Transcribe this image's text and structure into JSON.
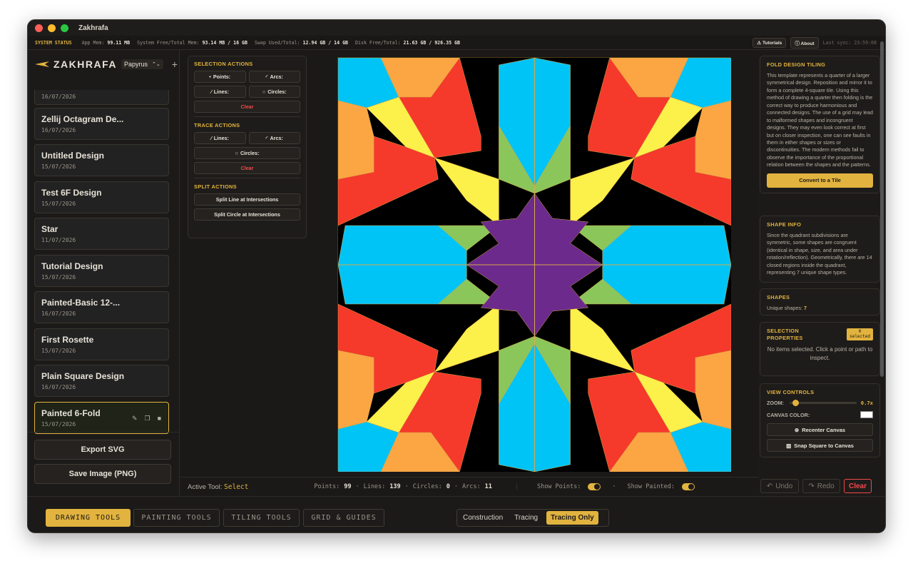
{
  "window": {
    "title": "Zakhrafa"
  },
  "status": {
    "label": "SYSTEM STATUS",
    "app_mem_label": "App Mem:",
    "app_mem": "99.11 MB",
    "sys_mem_label": "System Free/Total Mem:",
    "sys_mem": "93.14 MB / 16 GB",
    "swap_label": "Swap Used/Total:",
    "swap": "12.94 GB / 14 GB",
    "disk_label": "Disk Free/Total:",
    "disk": "21.63 GB / 926.35 GB",
    "tutorials": "Tutorials",
    "about": "About",
    "last_sync": "Last sync: 23:59:08"
  },
  "sidebar": {
    "logo": "ZAKHRAFA",
    "font": "Papyrus",
    "partial_date": "16/07/2026",
    "designs": [
      {
        "name": "Zellij Octagram De...",
        "date": "16/07/2026"
      },
      {
        "name": "Untitled Design",
        "date": "15/07/2026"
      },
      {
        "name": "Test 6F Design",
        "date": "15/07/2026"
      },
      {
        "name": "Star",
        "date": "11/07/2026"
      },
      {
        "name": "Tutorial Design",
        "date": "15/07/2026"
      },
      {
        "name": "Painted-Basic 12-...",
        "date": "16/07/2026"
      },
      {
        "name": "First Rosette",
        "date": "15/07/2026"
      },
      {
        "name": "Plain Square Design",
        "date": "16/07/2026"
      },
      {
        "name": "Painted 6-Fold",
        "date": "15/07/2026"
      }
    ],
    "export_svg": "Export SVG",
    "save_png": "Save Image (PNG)"
  },
  "actions": {
    "selection_title": "SELECTION ACTIONS",
    "points": "Points:",
    "arcs": "Arcs:",
    "lines": "Lines:",
    "circles": "Circles:",
    "clear": "Clear",
    "trace_title": "TRACE ACTIONS",
    "trace_lines": "Lines:",
    "trace_arcs": "Arcs:",
    "trace_circles": "Circles:",
    "trace_clear": "Clear",
    "split_title": "SPLIT ACTIONS",
    "split_line": "Split Line at Intersections",
    "split_circle": "Split Circle at Intersections"
  },
  "bottom_status": {
    "active_tool_label": "Active Tool:",
    "active_tool": "Select",
    "points_label": "Points:",
    "points": "99",
    "lines_label": "Lines:",
    "lines": "139",
    "circles_label": "Circles:",
    "circles": "0",
    "arcs_label": "Arcs:",
    "arcs": "11",
    "show_points": "Show Points:",
    "show_painted": "Show Painted:",
    "undo": "Undo",
    "redo": "Redo",
    "clear": "Clear"
  },
  "right": {
    "fold_title": "FOLD DESIGN TILING",
    "fold_text": "This template represents a quarter of a larger symmetrical design. Reposition and mirror it to form a complete 4-square tile. Using this method of drawing a quarter then folding is the correct way to produce harmonious and connected designs. The use of a grid may lead to malformed shapes and incongruent designs. They may even look correct at first but on closer inspection, one can see faults in them in either shapes or sizes or discontinuities. The modern methods fail to observe the importance of the proportional relation between the shapes and the patterns.",
    "convert_btn": "Convert to a Tile",
    "shape_title": "SHAPE INFO",
    "shape_text": "Since the quadrant subdivisions are symmetric, some shapes are congruent (identical in shape, size, and area under rotation/reflection). Geometrically, there are 14 closed regions inside the quadrant, representing 7 unique shape types.",
    "shapes_title": "SHAPES",
    "unique_label": "Unique shapes:",
    "unique": "7",
    "sel_title_1": "SELECTION",
    "sel_title_2": "PROPERTIES",
    "sel_badge_1": "0",
    "sel_badge_2": "selected",
    "sel_text": "No items selected. Click a point or path to inspect.",
    "view_title": "VIEW CONTROLS",
    "zoom_label": "ZOOM:",
    "zoom": "0.7x",
    "zoom_fraction": 0.04,
    "canvas_color_label": "CANVAS COLOR:",
    "recenter": "Recenter Canvas",
    "snap": "Snap Square to Canvas"
  },
  "tabs": {
    "drawing": "DRAWING TOOLS",
    "painting": "PAINTING TOOLS",
    "tiling": "TILING TOOLS",
    "grid": "GRID & GUIDES"
  },
  "modes": {
    "construction": "Construction",
    "tracing": "Tracing",
    "tracing_only": "Tracing Only"
  },
  "colors": {
    "accent": "#e2b33e",
    "red": "#f5392a",
    "blue": "#00c4f5",
    "yellow": "#fcf04a",
    "green": "#8bc65a",
    "purple": "#6b2a8c",
    "orange": "#fba543"
  }
}
